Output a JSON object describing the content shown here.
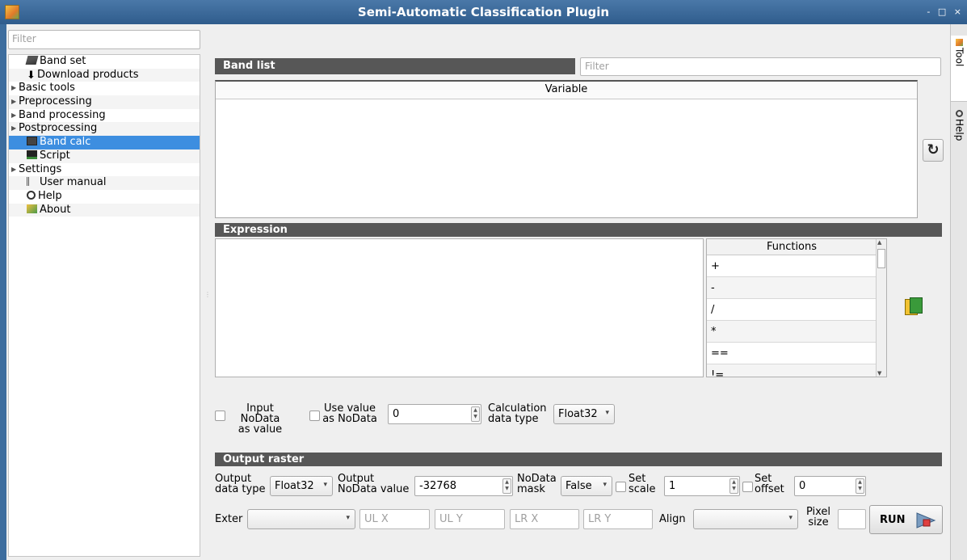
{
  "window": {
    "title": "Semi-Automatic Classification Plugin",
    "controls": "- □ ×"
  },
  "sidebar": {
    "filter_placeholder": "Filter",
    "items": [
      {
        "label": "Band set",
        "icon": "band-set-icon"
      },
      {
        "label": "Download products",
        "icon": "download-icon"
      },
      {
        "label": "Basic tools",
        "icon": "expand-arrow"
      },
      {
        "label": "Preprocessing",
        "icon": "expand-arrow"
      },
      {
        "label": "Band processing",
        "icon": "expand-arrow"
      },
      {
        "label": "Postprocessing",
        "icon": "expand-arrow"
      },
      {
        "label": "Band calc",
        "icon": "band-calc-icon",
        "selected": true
      },
      {
        "label": "Script",
        "icon": "script-icon"
      },
      {
        "label": "Settings",
        "icon": "expand-arrow"
      },
      {
        "label": "User manual",
        "icon": "manual-icon"
      },
      {
        "label": "Help",
        "icon": "help-icon"
      },
      {
        "label": "About",
        "icon": "about-icon"
      }
    ]
  },
  "band_list": {
    "header": "Band list",
    "filter_placeholder": "Filter",
    "column": "Variable"
  },
  "expression": {
    "header": "Expression",
    "functions_header": "Functions",
    "functions": [
      "+",
      "-",
      "/",
      "*",
      "==",
      "!="
    ]
  },
  "options": {
    "input_nodata_label": "Input NoData\nas value",
    "use_value_label": "Use value\nas NoData",
    "nodata_value": "0",
    "calc_type_label": "Calculation\ndata type",
    "calc_type_value": "Float32"
  },
  "output": {
    "header": "Output raster",
    "data_type_label": "Output\ndata type",
    "data_type_value": "Float32",
    "nodata_label": "Output\nNoData value",
    "nodata_value": "-32768",
    "mask_label": "NoData\nmask",
    "mask_value": "False",
    "scale_label": "Set\nscale",
    "scale_value": "1",
    "offset_label": "Set\noffset",
    "offset_value": "0",
    "extent_label": "Exter",
    "ulx_placeholder": "UL X",
    "uly_placeholder": "UL Y",
    "lrx_placeholder": "LR X",
    "lry_placeholder": "LR Y",
    "align_label": "Align",
    "pixel_size_label": "Pixel\nsize",
    "run_label": "RUN"
  },
  "right_tabs": {
    "tool": "Tool",
    "help": "Help"
  }
}
